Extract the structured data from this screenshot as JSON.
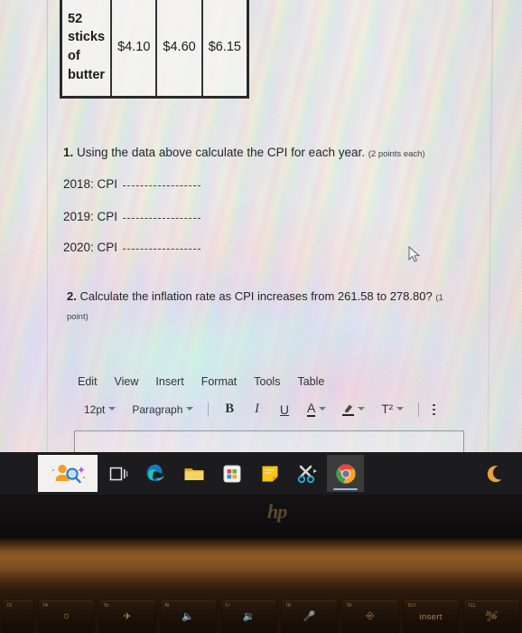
{
  "document": {
    "table": {
      "rows": [
        {
          "item": "52 sticks of butter",
          "prices": [
            "$4.10",
            "$4.60",
            "$6.15"
          ]
        }
      ]
    },
    "question1": {
      "number": "1.",
      "text": "Using the data above calculate the CPI for each year.",
      "points": "(2 points each)",
      "blanks": [
        {
          "label": "2018: CPI"
        },
        {
          "label": "2019: CPI"
        },
        {
          "label": "2020: CPI"
        }
      ]
    },
    "question2": {
      "number": "2.",
      "text": "Calculate the inflation rate as CPI increases from 261.58 to 278.80?",
      "points_inline": "(1",
      "points_wrap": "point)"
    }
  },
  "editor": {
    "menubar": [
      "Edit",
      "View",
      "Insert",
      "Format",
      "Tools",
      "Table"
    ],
    "toolbar": {
      "font_size": "12pt",
      "paragraph_style": "Paragraph",
      "bold": "B",
      "italic": "I",
      "underline": "U",
      "text_color": "A",
      "highlight": "highlighter-icon",
      "superscript": "T²",
      "more": "more-options-icon"
    },
    "textbox_value": ""
  },
  "taskbar": {
    "search": "search-person-icon",
    "items": [
      {
        "name": "task-view",
        "label": "Task View",
        "active": false
      },
      {
        "name": "microsoft-edge",
        "label": "Microsoft Edge",
        "active": false
      },
      {
        "name": "file-explorer",
        "label": "File Explorer",
        "active": false
      },
      {
        "name": "microsoft-store",
        "label": "Microsoft Store",
        "active": false
      },
      {
        "name": "sticky-notes",
        "label": "Sticky Notes",
        "active": false
      },
      {
        "name": "snipping-tool",
        "label": "Snipping Tool",
        "active": false
      },
      {
        "name": "google-chrome",
        "label": "Google Chrome",
        "active": true
      }
    ],
    "tray": [
      {
        "name": "night-light",
        "label": "Night light"
      }
    ]
  },
  "laptop": {
    "brand": "hp",
    "function_keys": [
      {
        "fn": "f4",
        "glyph": "brightness-icon",
        "type": "icon"
      },
      {
        "fn": "f5",
        "glyph": "airplane-icon",
        "type": "icon"
      },
      {
        "fn": "f6",
        "glyph": "volume-mute-icon",
        "type": "icon"
      },
      {
        "fn": "f7",
        "glyph": "volume-down-icon",
        "type": "icon"
      },
      {
        "fn": "f8",
        "glyph": "mic-mute-icon",
        "type": "icon"
      },
      {
        "fn": "f9",
        "glyph": "keyboard-backlight-icon",
        "type": "icon"
      },
      {
        "fn": "f10",
        "glyph": "insert",
        "type": "text"
      },
      {
        "fn": "f11",
        "glyph": "airplane-mode-icon",
        "type": "icon"
      }
    ]
  }
}
